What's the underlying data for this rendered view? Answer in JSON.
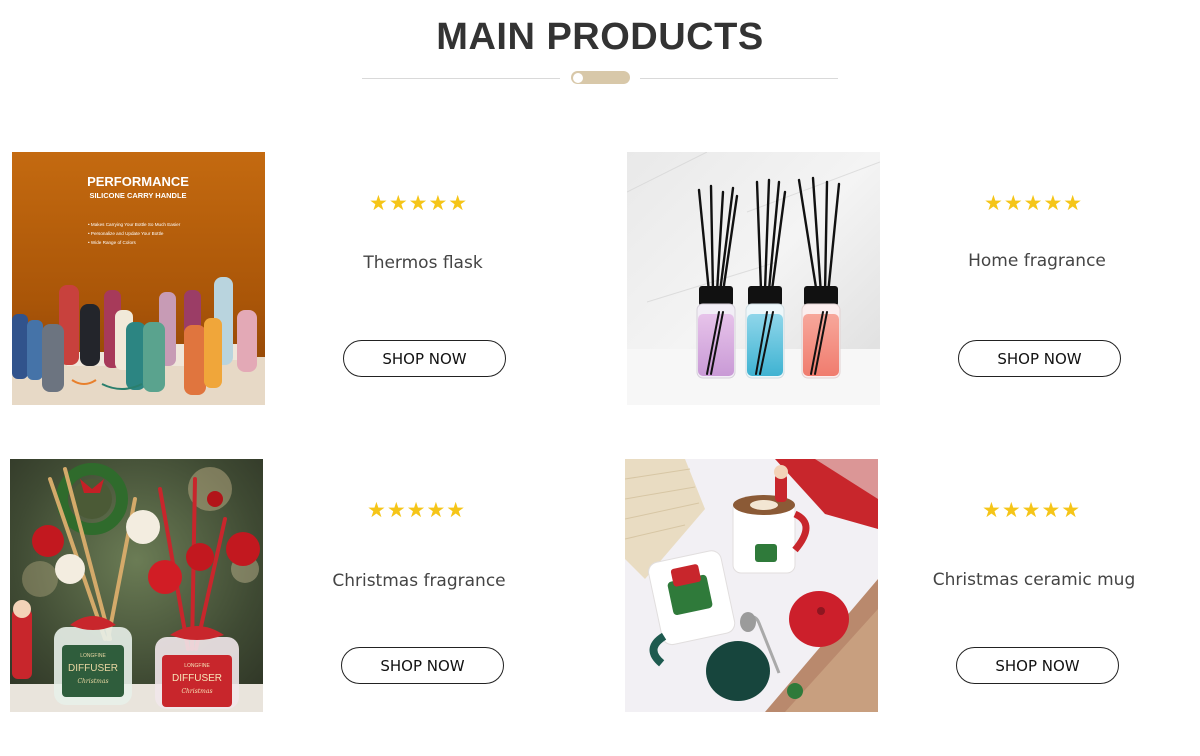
{
  "section": {
    "title": "MAIN PRODUCTS"
  },
  "products": [
    {
      "name": "Thermos flask",
      "button_label": "SHOP NOW",
      "rating_stars": "★★★★★",
      "rating": 5,
      "image": {
        "icon": "thermos-bottles-image",
        "heading": "PERFORMANCE",
        "subheading": "SILICONE CARRY HANDLE",
        "bullets": [
          "• Makes Carrying Your Bottle So Much Easier",
          "• Personalize and Update Your Bottle",
          "• Wide Range of Colors"
        ]
      }
    },
    {
      "name": "Home fragrance",
      "button_label": "SHOP NOW",
      "rating_stars": "★★★★★",
      "rating": 5,
      "image": {
        "icon": "reed-diffuser-image"
      }
    },
    {
      "name": "Christmas fragrance",
      "button_label": "SHOP NOW",
      "rating_stars": "★★★★★",
      "rating": 5,
      "image": {
        "icon": "christmas-diffuser-image",
        "label_left_top": "LONGFINE",
        "label_left_main": "DIFFUSER",
        "label_left_script": "Christmas",
        "label_right_top": "LONGFINE",
        "label_right_main": "DIFFUSER",
        "label_right_script": "Christmas"
      }
    },
    {
      "name": "Christmas ceramic mug",
      "button_label": "SHOP NOW",
      "rating_stars": "★★★★★",
      "rating": 5,
      "image": {
        "icon": "ceramic-mug-image"
      }
    }
  ],
  "colors": {
    "accent": "#d8c8a9",
    "star": "#f5c518",
    "title": "#333333"
  }
}
